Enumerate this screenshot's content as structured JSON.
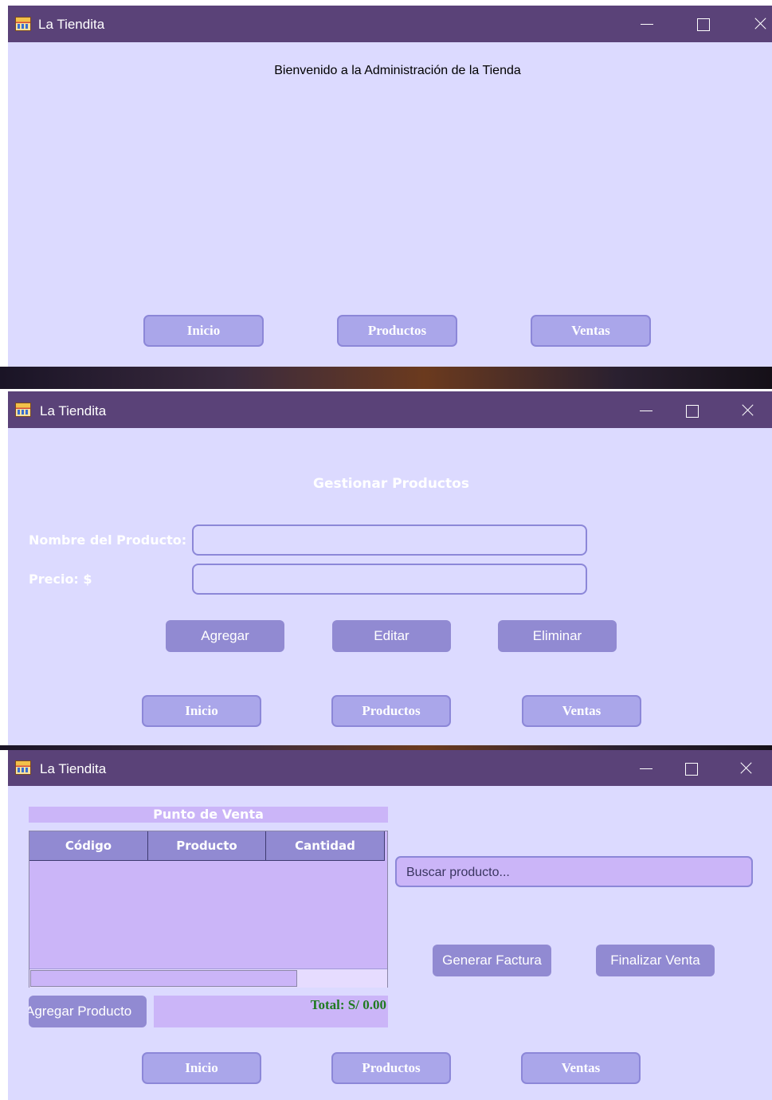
{
  "app": {
    "title": "La Tiendita"
  },
  "nav": {
    "inicio": "Inicio",
    "productos": "Productos",
    "ventas": "Ventas"
  },
  "home_window": {
    "welcome": "Bienvenido a la Administración de la Tienda"
  },
  "products_window": {
    "heading": "Gestionar Productos",
    "name_label": "Nombre del Producto:",
    "price_label": "Precio: $",
    "name_value": "",
    "price_value": "",
    "add_button": "Agregar",
    "edit_button": "Editar",
    "delete_button": "Eliminar"
  },
  "sales_window": {
    "heading": "Punto de Venta",
    "columns": [
      "Código",
      "Producto",
      "Cantidad"
    ],
    "rows": [],
    "search_placeholder": "Buscar producto...",
    "invoice_button": "Generar Factura",
    "finish_button": "Finalizar Venta",
    "add_product_button": "Agregar Producto",
    "total": "Total: S/ 0.00"
  },
  "colors": {
    "titlebar": "#5a4278",
    "window_bg": "#dcdaff",
    "button_bg": "#aaa6ea",
    "accent": "#918ad2",
    "table_body": "#cbb5f8",
    "total_text": "#1f7a1f"
  }
}
